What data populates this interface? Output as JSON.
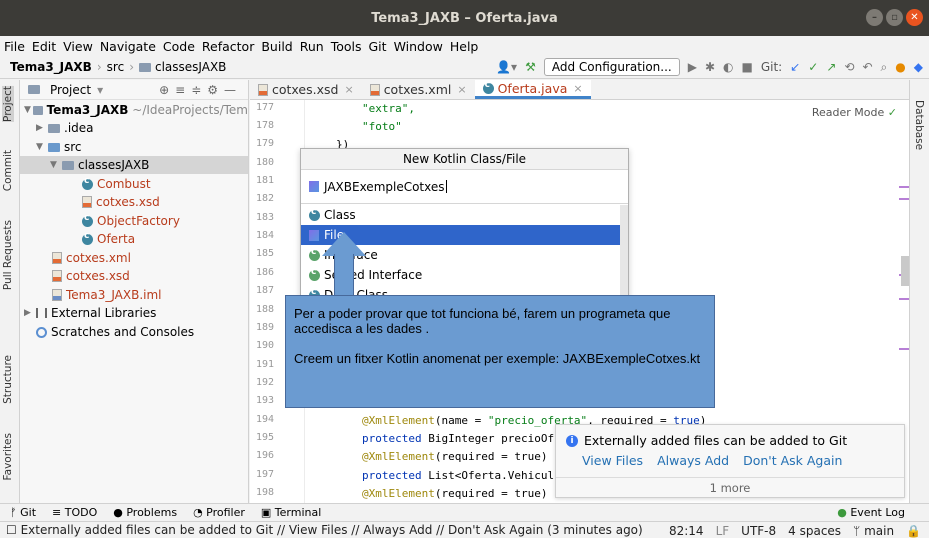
{
  "window": {
    "title": "Tema3_JAXB – Oferta.java",
    "buttons": [
      "–",
      "▫",
      "✕"
    ]
  },
  "menu": [
    "File",
    "Edit",
    "View",
    "Navigate",
    "Code",
    "Refactor",
    "Build",
    "Run",
    "Tools",
    "Git",
    "Window",
    "Help"
  ],
  "breadcrumb": {
    "project": "Tema3_JAXB",
    "sep1": "›",
    "src": "src",
    "sep2": "›",
    "folder": "classesJAXB"
  },
  "toolbar": {
    "add_config": "Add Configuration...",
    "git_label": "Git:"
  },
  "left_tabs": [
    "Project",
    "Commit",
    "Pull Requests",
    "Structure",
    "Favorites"
  ],
  "right_tabs": [
    "Database"
  ],
  "project_panel": {
    "title": "Project",
    "tree": [
      {
        "label": "Tema3_JAXB",
        "suffix": "~/IdeaProjects/Tem",
        "type": "project"
      },
      {
        "label": ".idea",
        "type": "folder"
      },
      {
        "label": "src",
        "type": "folder"
      },
      {
        "label": "classesJAXB",
        "type": "folder"
      },
      {
        "label": "Combust",
        "type": "class"
      },
      {
        "label": "cotxes.xsd",
        "type": "xml"
      },
      {
        "label": "ObjectFactory",
        "type": "class"
      },
      {
        "label": "Oferta",
        "type": "class"
      },
      {
        "label": "cotxes.xml",
        "type": "xml"
      },
      {
        "label": "cotxes.xsd",
        "type": "xml"
      },
      {
        "label": "Tema3_JAXB.iml",
        "type": "iml"
      },
      {
        "label": "External Libraries",
        "type": "lib"
      },
      {
        "label": "Scratches and Consoles",
        "type": "scratch"
      }
    ]
  },
  "tabs": [
    {
      "label": "cotxes.xsd",
      "close": "×"
    },
    {
      "label": "cotxes.xml",
      "close": "×"
    },
    {
      "label": "Oferta.java",
      "close": "×"
    }
  ],
  "editor": {
    "reader_mode": "Reader Mode",
    "line_numbers": [
      "177",
      "178",
      "179",
      "180",
      "181",
      "182",
      "183",
      "184",
      "185",
      "186",
      "187",
      "188",
      "189",
      "190",
      "191",
      "192",
      "193",
      "194",
      "195",
      "196",
      "197",
      "198"
    ],
    "code": {
      "l177": "\"extra\",",
      "l178": "\"foto\"",
      "l179": "})",
      "l194a": "@XmlElement",
      "l194b": "(name = ",
      "l194c": "\"precio_oferta\"",
      "l194d": ", required = ",
      "l194e": "true",
      "l194f": ")",
      "l195a": "protected",
      "l195b": " BigInteger precioOf",
      "l196a": "@XmlElement",
      "l196b": "(required = true)",
      "l197a": "protected",
      "l197b": " List<Oferta.Vehicul",
      "l198a": "@XmlElement",
      "l198b": "(required = true)"
    }
  },
  "new_kotlin_popup": {
    "title": "New Kotlin Class/File",
    "input": "JAXBExempleCotxes",
    "kinds": [
      "Class",
      "File",
      "Interface",
      "Sealed Interface",
      "Data Class"
    ]
  },
  "annotation": {
    "p1": "Per a poder provar que tot funciona bé, farem un programeta que accedisca a les dades .",
    "p2": "Creem un fitxer Kotlin anomenat per exemple: JAXBExempleCotxes.kt"
  },
  "notification": {
    "message": "Externally added files can be added to Git",
    "links": [
      "View Files",
      "Always Add",
      "Don't Ask Again"
    ],
    "more": "1 more"
  },
  "bottom_tools": [
    "Git",
    "TODO",
    "Problems",
    "Profiler",
    "Terminal",
    "Event Log"
  ],
  "status": {
    "message": "Externally added files can be added to Git // View Files // Always Add // Don't Ask Again (3 minutes ago)",
    "position": "82:14",
    "line_sep": "LF",
    "encoding": "UTF-8",
    "indent": "4 spaces",
    "branch": "main"
  }
}
